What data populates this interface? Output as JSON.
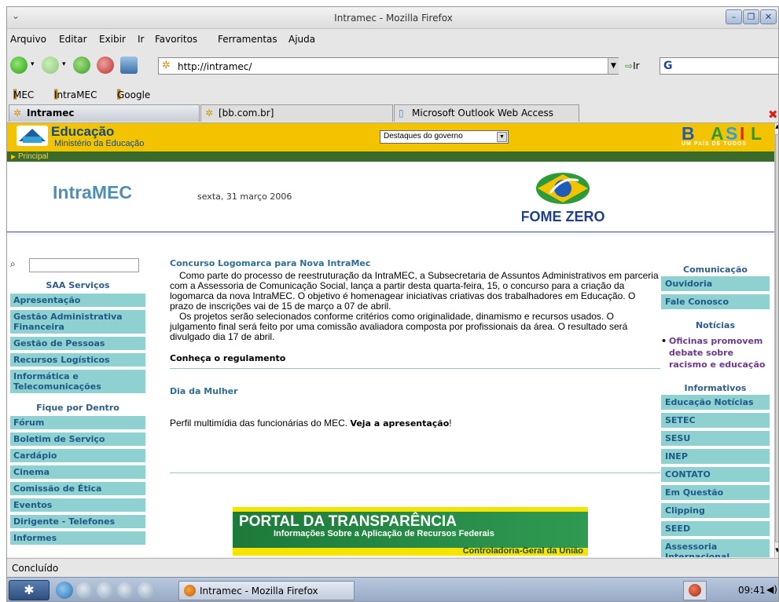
{
  "window": {
    "title": "Intramec - Mozilla Firefox"
  },
  "menu": [
    "Arquivo",
    "Editar",
    "Exibir",
    "Ir",
    "Favoritos",
    "Ferramentas",
    "Ajuda"
  ],
  "nav": {
    "url": "http://intramec/",
    "go_label": "Ir",
    "search_engine": "G"
  },
  "bookmarks": [
    "MEC",
    "IntraMEC",
    "Google"
  ],
  "tabs": [
    {
      "label": "Intramec",
      "active": true
    },
    {
      "label": "[bb.com.br]",
      "active": false
    },
    {
      "label": "Microsoft Outlook Web Access",
      "active": false
    }
  ],
  "gov": {
    "educacao": "Educação",
    "ministerio": "Ministério da Educação",
    "select_value": "Destaques do governo",
    "brasil": "BRASIL",
    "brasil_sub": "UM PAÍS DE TODOS",
    "breadcrumb": "Principal"
  },
  "header": {
    "intra": "Intra",
    "mec": "MEC",
    "date": "sexta, 31 março 2006",
    "fome": "FOME ZERO"
  },
  "left": {
    "section1": "SAA Serviços",
    "items1": [
      "Apresentação",
      "Gestão Administrativa Financeira",
      "Gestão de Pessoas",
      "Recursos Logísticos",
      "Informática e Telecomunicações"
    ],
    "section2": "Fique por Dentro",
    "items2": [
      "Fórum",
      "Boletim de Serviço",
      "Cardápio",
      "Cinema",
      "Comissão de Ética",
      "Eventos",
      "Dirigente - Telefones",
      "Informes"
    ]
  },
  "center": {
    "news1_title": "Concurso Logomarca para Nova IntraMec",
    "news1_p1": "Como parte do processo de reestruturação da IntraMEC, a Subsecretaria de Assuntos Administrativos em parceria com a Assessoria de Comunicação Social, lança a partir desta quarta-feira, 15, o concurso para a criação da logomarca da nova IntraMEC. O objetivo é homenagear iniciativas criativas dos trabalhadores em Educação. O prazo de inscrições vai de 15 de março a 07 de abril.",
    "news1_p2": "Os projetos serão selecionados conforme critérios como originalidade, dinamismo e recursos usados. O julgamento final será feito por uma comissão avaliadora composta por profissionais da área. O resultado será divulgado dia 17 de abril.",
    "news1_link": "Conheça o regulamento",
    "news2_title": "Dia da Mulher",
    "news2_text": "Perfil multimídia das funcionárias do MEC.",
    "news2_link": "Veja a apresentação",
    "news2_after": "!",
    "portal_title": "PORTAL DA TRANSPARÊNCIA",
    "portal_sub": "Informações Sobre a Aplicação de Recursos Federais",
    "portal_cgu": "Controladoria-Geral da União"
  },
  "right": {
    "section1": "Comunicação",
    "items1": [
      "Ouvidoria",
      "Fale Conosco"
    ],
    "section2": "Notícias",
    "news": "Oficinas promovem debate sobre racismo e educação",
    "section3": "Informativos",
    "items3": [
      "Educação Notícias",
      "SETEC",
      "SESU",
      "INEP",
      "CONTATO",
      "Em Questão",
      "Clipping",
      "SEED",
      "Assessoria Internacional"
    ]
  },
  "status": {
    "text": "Concluído"
  },
  "taskbar": {
    "task": "Intramec - Mozilla Firefox",
    "clock": "09:41"
  }
}
